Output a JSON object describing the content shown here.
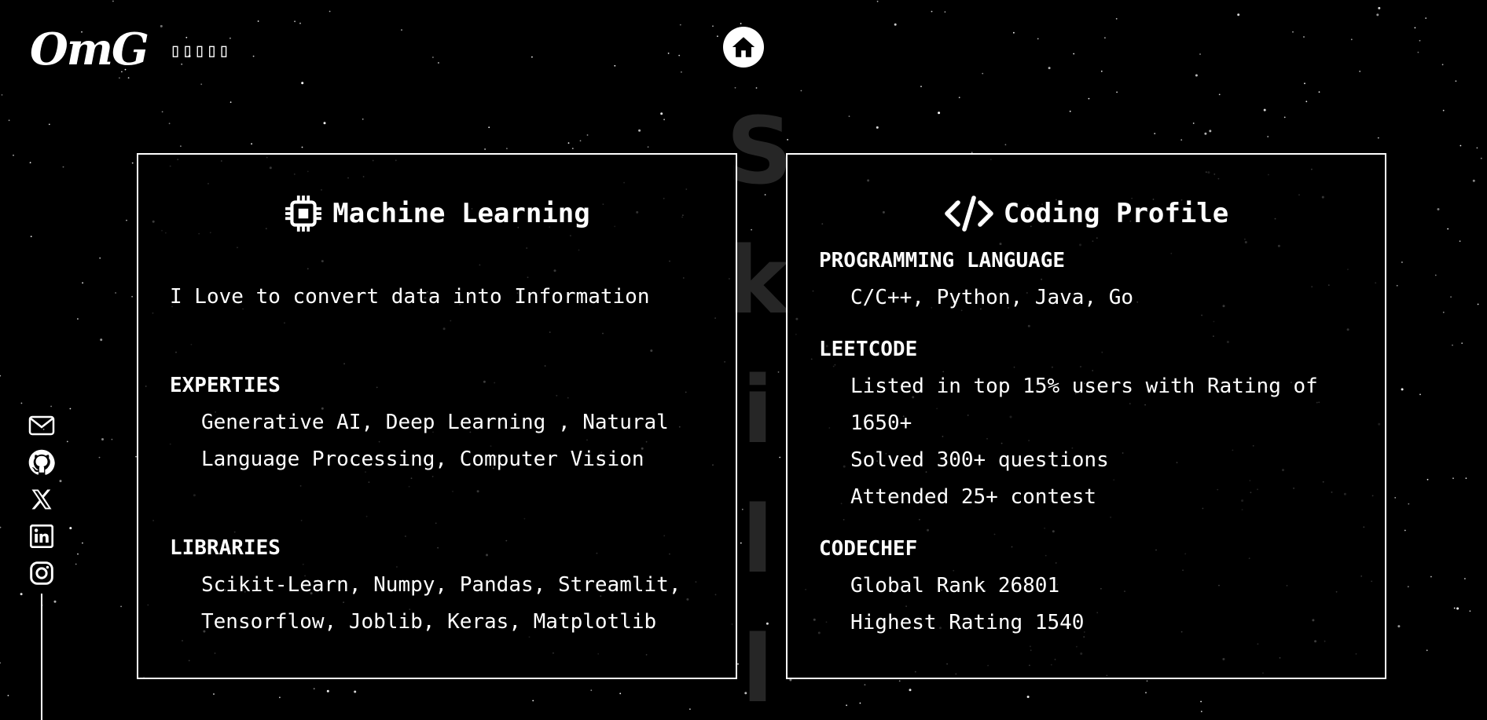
{
  "header": {
    "logo_text": "OmG",
    "menu_glyphs": "▯▯▯▯▯",
    "home_icon": "home-icon"
  },
  "background": {
    "vertical_text": "Skill"
  },
  "cards": {
    "ml": {
      "icon": "chip-icon",
      "title": "Machine Learning",
      "intro": "I Love to convert data into Information",
      "expertise_heading": "EXPERTIES",
      "expertise_text": "Generative AI, Deep Learning , Natural Language Processing, Computer Vision",
      "libraries_heading": "LIBRARIES",
      "libraries_text": "Scikit-Learn, Numpy, Pandas, Streamlit, Tensorflow, Joblib, Keras, Matplotlib"
    },
    "coding": {
      "icon": "code-icon",
      "title": "Coding Profile",
      "lang_heading": "PROGRAMMING LANGUAGE",
      "lang_text": "C/C++, Python, Java, Go",
      "leetcode_heading": "LEETCODE",
      "leetcode_items": [
        "Listed in top 15% users with Rating of 1650+",
        "Solved 300+ questions",
        "Attended 25+ contest"
      ],
      "codechef_heading": "CODECHEF",
      "codechef_items": [
        "Global Rank 26801",
        "Highest Rating 1540"
      ]
    }
  },
  "socials": [
    "mail-icon",
    "github-icon",
    "x-icon",
    "linkedin-icon",
    "instagram-icon"
  ],
  "colors": {
    "background": "#000000",
    "foreground": "#ffffff",
    "watermark": "#262626"
  }
}
